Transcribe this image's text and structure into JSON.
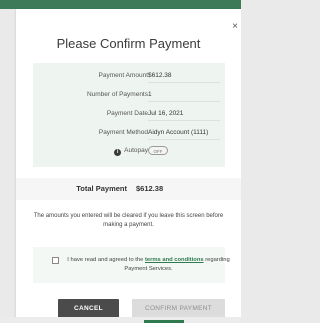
{
  "modal": {
    "title": "Please Confirm Payment",
    "close_glyph": "×"
  },
  "details": {
    "rows": [
      {
        "label": "Payment Amount",
        "value": "$612.38"
      },
      {
        "label": "Number of Payments",
        "value": "1"
      },
      {
        "label": "Payment Date",
        "value": "Jul 16, 2021"
      },
      {
        "label": "Payment Method",
        "value": "Aidyn Account (1111)"
      }
    ],
    "autopay": {
      "label": "Autopay",
      "icon": "info-icon",
      "toggle_text": "OFF",
      "enabled": false
    }
  },
  "total": {
    "label": "Total Payment",
    "value": "$612.38"
  },
  "warning": "The amounts you entered will be cleared if you leave this screen before making a payment.",
  "agreement": {
    "checked": false,
    "text_before": "I have read and agreed to the ",
    "link_text": "terms and conditions",
    "text_after": " regarding Payment Services."
  },
  "buttons": {
    "cancel_label": "CANCEL",
    "confirm_label": "CONFIRM PAYMENT"
  },
  "colors": {
    "brand_green": "#3c7a58",
    "link_green": "#2f7a4f",
    "detail_bg": "#eef5f0",
    "cancel_bg": "#4b4b4b",
    "confirm_disabled_bg": "#dcdcdc"
  }
}
